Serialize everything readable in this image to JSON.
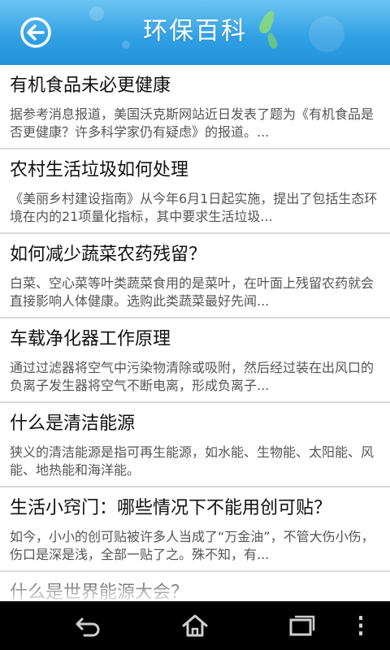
{
  "header": {
    "title": "环保百科",
    "back_icon": "back-arrow-icon",
    "background_color": "#2f9fe3"
  },
  "articles": [
    {
      "title": "有机食品未必更健康",
      "summary": "据参考消息报道，美国沃克斯网站近日发表了题为《有机食品是否更健康？许多科学家仍有疑虑》的报道。..."
    },
    {
      "title": "农村生活垃圾如何处理",
      "summary": "《美丽乡村建设指南》从今年6月1日起实施，提出了包括生态环境在内的21项量化指标，其中要求生活垃圾..."
    },
    {
      "title": "如何减少蔬菜农药残留？",
      "summary": "白菜、空心菜等叶类蔬菜食用的是菜叶，在叶面上残留农药就会直接影响人体健康。选购此类蔬菜最好先闻..."
    },
    {
      "title": "车载净化器工作原理",
      "summary": "通过过滤器将空气中污染物清除或吸附，然后经过装在出风口的负离子发生器将空气不断电离，形成负离子..."
    },
    {
      "title": "什么是清洁能源",
      "summary": "狭义的清洁能源是指可再生能源，如水能、生物能、太阳能、风能、地热能和海洋能。"
    },
    {
      "title": "生活小窍门：哪些情况下不能用创可贴？",
      "summary": "如今，小小的创可贴被许多人当成了“万金油”，不管大伤小伤，伤口是深是浅，全部一贴了之。殊不知，有..."
    },
    {
      "title": "什么是世界能源大会？",
      "summary": ""
    }
  ],
  "navbar": {
    "buttons": [
      "back-icon",
      "home-icon",
      "recent-apps-icon",
      "menu-icon"
    ]
  }
}
